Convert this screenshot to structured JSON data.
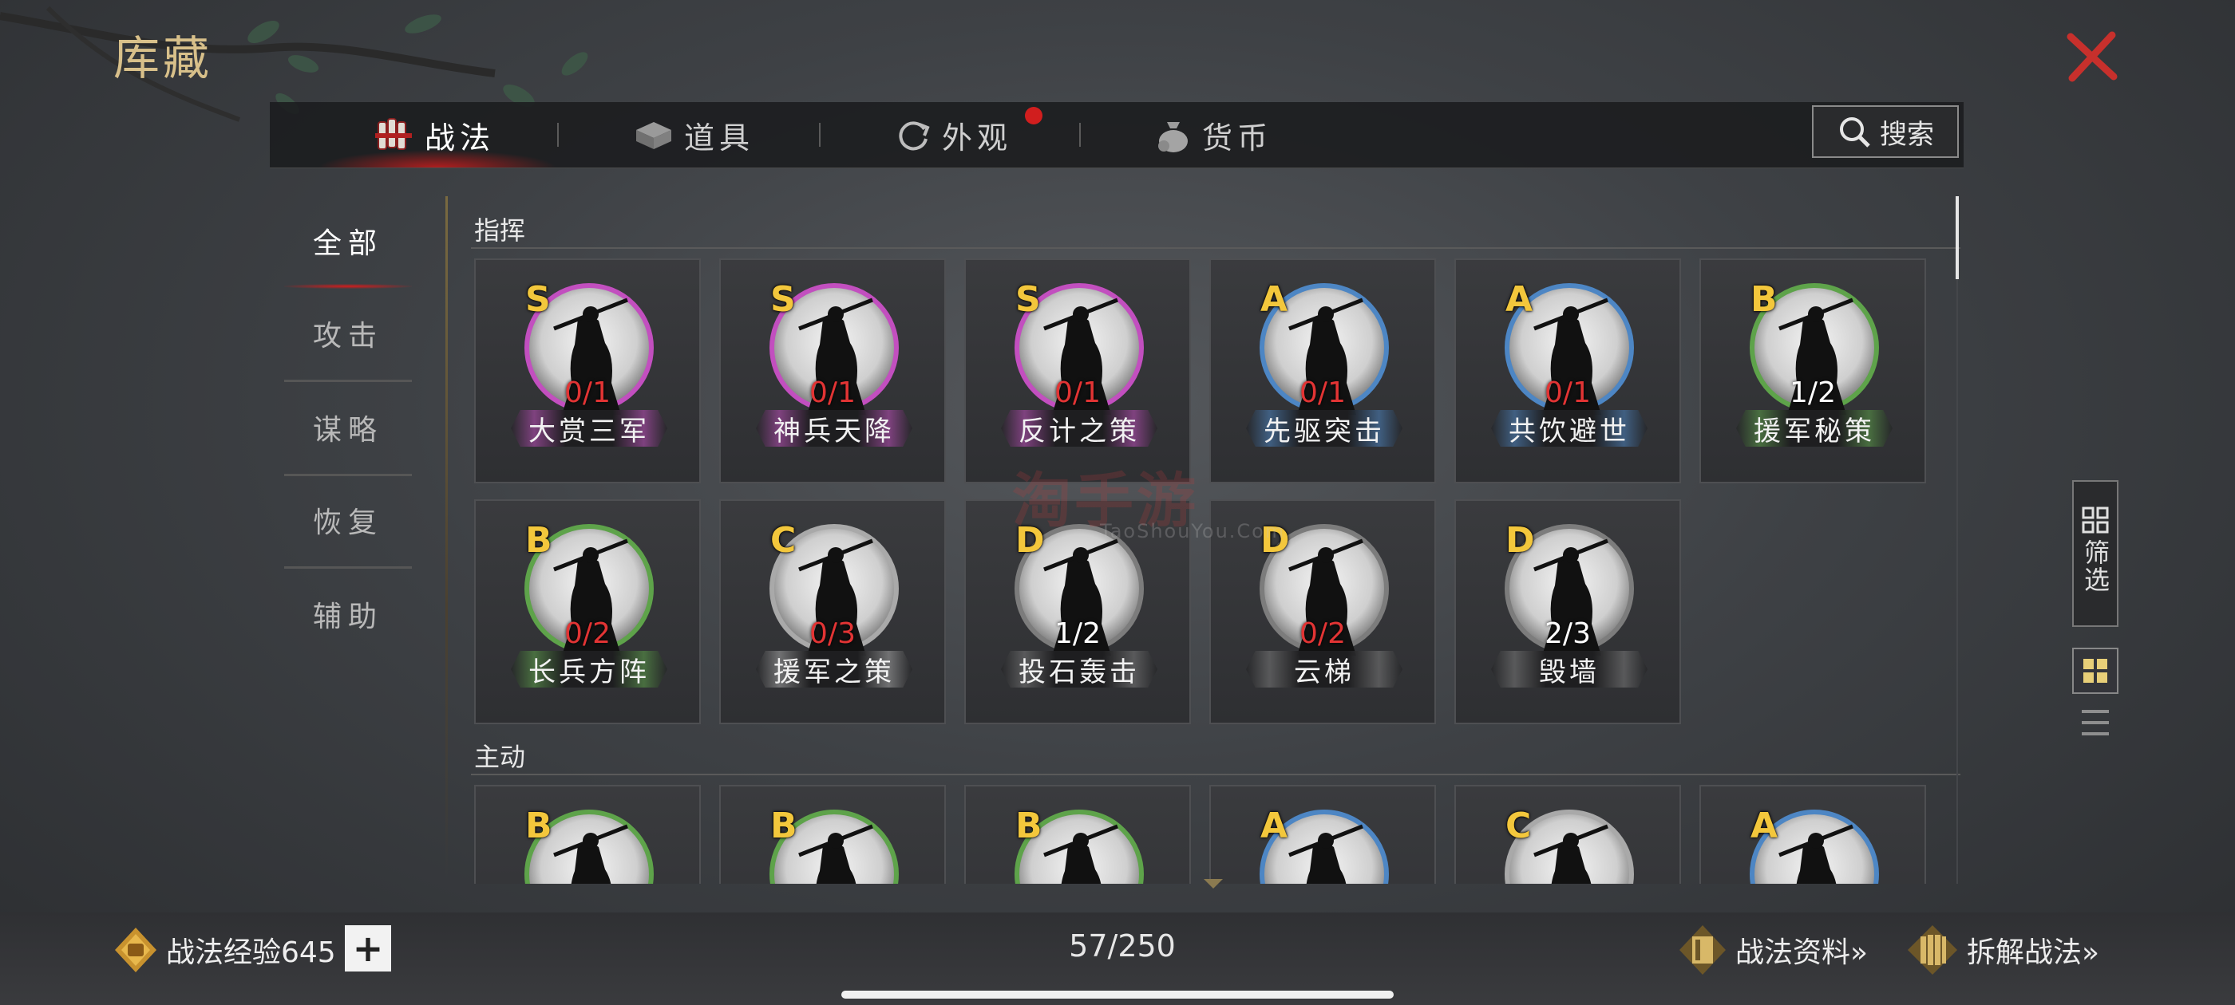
{
  "header": {
    "title": "库藏",
    "close_icon": "close-icon"
  },
  "tabs": [
    {
      "label": "战法",
      "icon": "scroll-bundle-icon",
      "active": true,
      "dot": false
    },
    {
      "label": "道具",
      "icon": "box-icon",
      "active": false,
      "dot": false
    },
    {
      "label": "外观",
      "icon": "refresh-icon",
      "active": false,
      "dot": true
    },
    {
      "label": "货币",
      "icon": "money-bag-icon",
      "active": false,
      "dot": false
    }
  ],
  "search": {
    "label": "搜索",
    "icon": "search-icon"
  },
  "sidebar": [
    {
      "label": "全部",
      "active": true
    },
    {
      "label": "攻击",
      "active": false
    },
    {
      "label": "谋略",
      "active": false
    },
    {
      "label": "恢复",
      "active": false
    },
    {
      "label": "辅助",
      "active": false
    }
  ],
  "sections": [
    {
      "title": "指挥",
      "cards": [
        {
          "grade": "S",
          "count": "0/1",
          "name": "大赏三军",
          "red": true
        },
        {
          "grade": "S",
          "count": "0/1",
          "name": "神兵天降",
          "red": true
        },
        {
          "grade": "S",
          "count": "0/1",
          "name": "反计之策",
          "red": true
        },
        {
          "grade": "A",
          "count": "0/1",
          "name": "先驱突击",
          "red": true
        },
        {
          "grade": "A",
          "count": "0/1",
          "name": "共饮避世",
          "red": true
        },
        {
          "grade": "B",
          "count": "1/2",
          "name": "援军秘策",
          "red": false
        },
        {
          "grade": "B",
          "count": "0/2",
          "name": "长兵方阵",
          "red": true
        },
        {
          "grade": "C",
          "count": "0/3",
          "name": "援军之策",
          "red": true
        },
        {
          "grade": "D",
          "count": "1/2",
          "name": "投石轰击",
          "red": false
        },
        {
          "grade": "D",
          "count": "0/2",
          "name": "云梯",
          "red": true
        },
        {
          "grade": "D",
          "count": "2/3",
          "name": "毁墙",
          "red": false
        }
      ]
    },
    {
      "title": "主动",
      "cards": [
        {
          "grade": "B"
        },
        {
          "grade": "B"
        },
        {
          "grade": "B"
        },
        {
          "grade": "A"
        },
        {
          "grade": "C"
        },
        {
          "grade": "A"
        }
      ]
    }
  ],
  "grade_colors": {
    "S": "#c24fbf",
    "A": "#4d86c4",
    "B": "#5ea34a",
    "C": "#a9a9a9",
    "D": "#7c7c7c"
  },
  "filter": {
    "label": "筛选",
    "icon": "grid-filter-icon"
  },
  "view_toggle": {
    "grid_icon": "grid-view-icon",
    "list_icon": "list-view-icon"
  },
  "watermark": {
    "text": "淘手游",
    "sub": "TaoShouYou.Com"
  },
  "footer": {
    "exp_label": "战法经验645",
    "exp_icon": "fist-badge-icon",
    "plus_label": "+",
    "page_count": "57/250",
    "info_link": "战法资料»",
    "info_icon": "scroll-book-icon",
    "dismantle_link": "拆解战法»",
    "dismantle_icon": "scroll-bundle-icon"
  }
}
